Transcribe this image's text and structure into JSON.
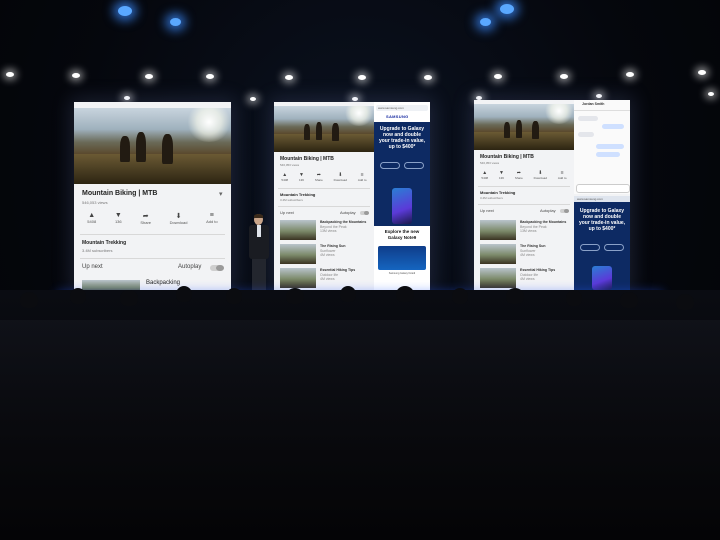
{
  "scene": {
    "colors": {
      "stage_blue": "#2e59ff",
      "screen_bg": "#f2f3f5",
      "samsung_blue": "#0d2a63"
    }
  },
  "left_screen": {
    "video_title": "Mountain Biking | MTB",
    "views": "546,053 views",
    "actions": [
      {
        "icon": "thumbs-up-icon",
        "label": "5408"
      },
      {
        "icon": "thumbs-down-icon",
        "label": "136"
      },
      {
        "icon": "share-icon",
        "label": "Share"
      },
      {
        "icon": "download-icon",
        "label": "Download"
      },
      {
        "icon": "add-to-icon",
        "label": "Add to"
      }
    ],
    "channel_name": "Mountain Trekking",
    "subscribers": "3.4M subscribers",
    "up_next": "Up next",
    "autoplay": "Autoplay",
    "next_video": "Backpacking"
  },
  "middle_screen": {
    "video_title": "Mountain Biking | MTB",
    "views": "546,053 views",
    "actions": [
      "5408",
      "136",
      "Share",
      "Download",
      "Add to"
    ],
    "channel_name": "Mountain Trekking",
    "subscribers": "3.4M subscribers",
    "up_next": "Up next",
    "autoplay": "Autoplay",
    "list": [
      {
        "title": "Backpacking the Mountains",
        "sub": "Beyond the Peak",
        "meta": "13M views"
      },
      {
        "title": "The Rising Sun",
        "sub": "Sunflower",
        "meta": "4M views"
      },
      {
        "title": "Essential Hiking Tips",
        "sub": "Outdoor life",
        "meta": "4M views"
      }
    ],
    "browser": {
      "url": "www.samsung.com",
      "brand": "SAMSUNG",
      "headline": "Upgrade to Galaxy now and double your trade-in value, up to $400*",
      "promo": "Explore the new Galaxy Note9",
      "bottom": "Samsung Galaxy Note9"
    }
  },
  "right_screen": {
    "video_title": "Mountain Biking | MTB",
    "views": "546,053 views",
    "actions": [
      "5408",
      "136",
      "Share",
      "Download",
      "Add to"
    ],
    "channel_name": "Mountain Trekking",
    "subscribers": "3.4M subscribers",
    "up_next": "Up next",
    "autoplay": "Autoplay",
    "list": [
      {
        "title": "Backpacking the Mountains",
        "sub": "Beyond the Peak",
        "meta": "13M views"
      },
      {
        "title": "The Rising Sun",
        "sub": "Sunflower",
        "meta": "4M views"
      },
      {
        "title": "Essential Hiking Tips",
        "sub": "Outdoor life",
        "meta": "4M views"
      }
    ],
    "chat": {
      "contact": "Jordan Smith"
    },
    "browser": {
      "url": "www.samsung.com",
      "headline": "Upgrade to Galaxy now and double your trade-in value, up to $400*"
    }
  }
}
